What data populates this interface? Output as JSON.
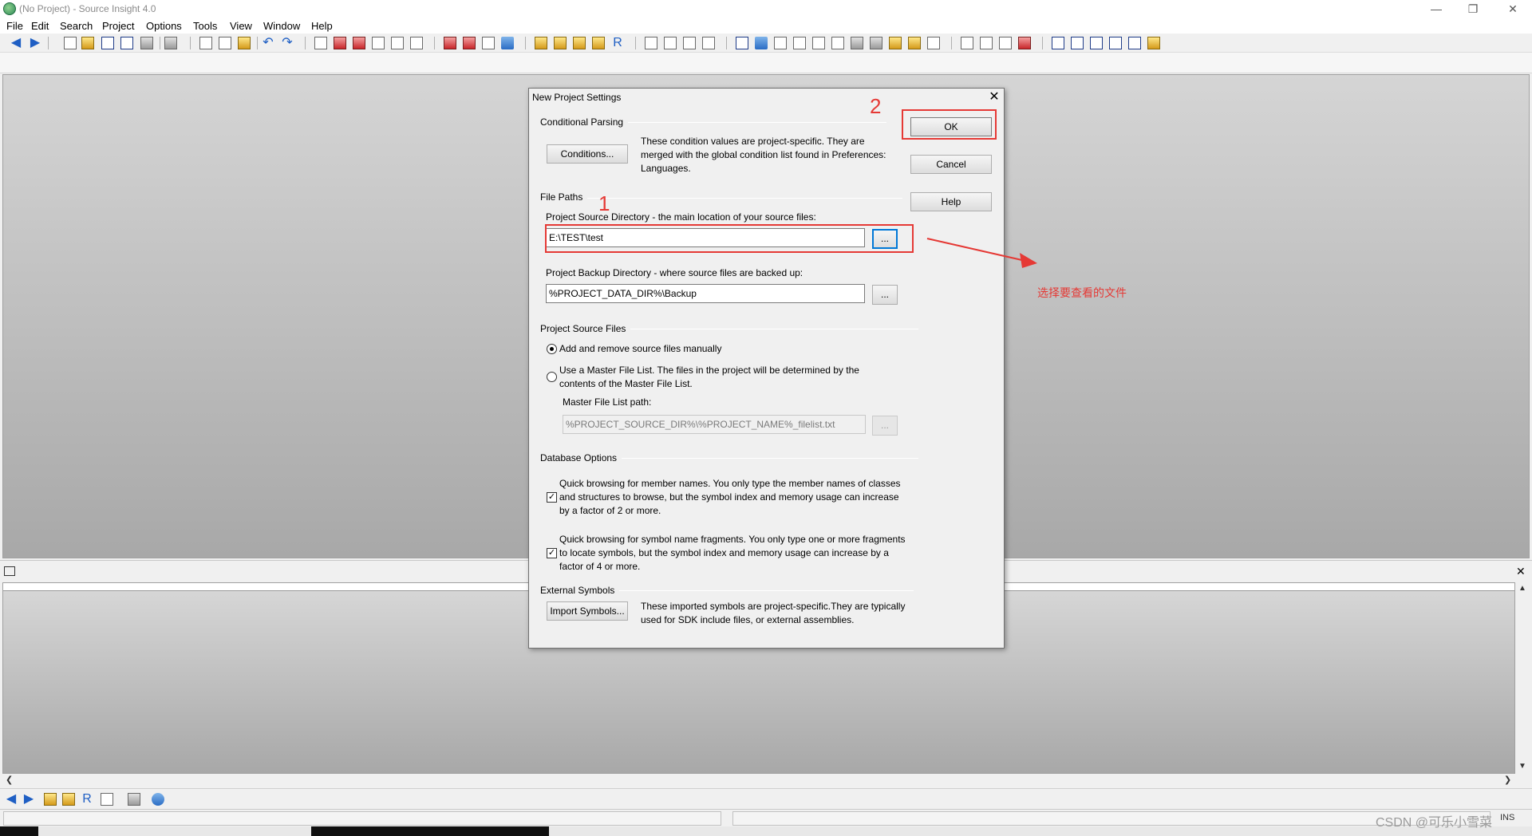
{
  "window": {
    "title": "(No Project) - Source Insight 4.0",
    "minimize_icon": "minimize-icon",
    "restore_icon": "restore-icon",
    "close_icon": "close-icon"
  },
  "menu": [
    "File",
    "Edit",
    "Search",
    "Project",
    "Options",
    "Tools",
    "View",
    "Window",
    "Help"
  ],
  "dialog": {
    "title": "New Project Settings",
    "close": "✕",
    "conditional_parsing": {
      "label": "Conditional Parsing",
      "button": "Conditions...",
      "description": "These condition values are project-specific.  They are merged with the global condition list found in Preferences: Languages."
    },
    "buttons": {
      "ok": "OK",
      "cancel": "Cancel",
      "help": "Help"
    },
    "file_paths": {
      "label": "File Paths",
      "source_dir_label": "Project Source Directory - the main location of your source files:",
      "source_dir_value": "E:\\TEST\\test",
      "browse": "...",
      "backup_dir_label": "Project Backup Directory - where source files are backed up:",
      "backup_dir_value": "%PROJECT_DATA_DIR%\\Backup"
    },
    "source_files": {
      "label": "Project Source Files",
      "option_manual": "Add and remove source files manually",
      "option_master": "Use a Master File List. The files in the project will be determined by the contents of the Master File List.",
      "master_path_label": "Master File List path:",
      "master_path_value": "%PROJECT_SOURCE_DIR%\\%PROJECT_NAME%_filelist.txt",
      "selected": "manual"
    },
    "database": {
      "label": "Database Options",
      "member_names": "Quick browsing for member names.  You only type the member names of classes and structures to browse, but the symbol index and memory usage can increase by a factor of 2 or more.",
      "member_names_checked": true,
      "fragments": "Quick browsing for symbol name fragments.  You only type one or more fragments to locate symbols, but the symbol index and memory usage can increase by a factor of 4 or more.",
      "fragments_checked": true
    },
    "external_symbols": {
      "label": "External Symbols",
      "button": "Import Symbols...",
      "description": "These imported symbols are project-specific.They are typically used for SDK include files, or external assemblies."
    }
  },
  "annotations": {
    "step1": "1",
    "step2": "2",
    "note": "选择要查看的文件"
  },
  "status": {
    "ins": "INS"
  },
  "watermark": "CSDN @可乐小雪菜"
}
